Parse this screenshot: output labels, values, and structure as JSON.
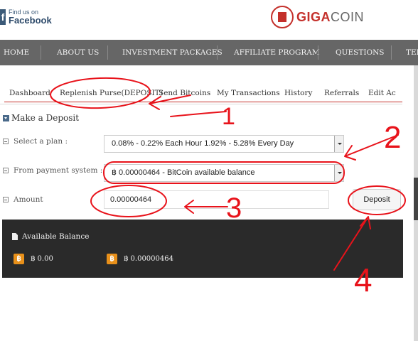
{
  "header": {
    "facebook": {
      "small": "Find us on",
      "big": "Facebook",
      "icon": "facebook-icon"
    },
    "logo": {
      "giga": "GIGA",
      "coin": "COIN",
      "icon": "gigacoin-seal-icon"
    }
  },
  "nav": {
    "items": [
      "HOME",
      "ABOUT US",
      "INVESTMENT PACKAGES",
      "AFFILIATE PROGRAM",
      "QUESTIONS",
      "TER"
    ]
  },
  "tabs": {
    "items": [
      "Dashboard",
      "Replenish Purse(DEPOSIT)",
      "Send Bitcoins",
      "My Transactions",
      "History",
      "Referrals",
      "Edit Ac"
    ]
  },
  "form": {
    "title": "Make a Deposit",
    "plan_label": "Select a plan :",
    "plan_value": "0.08% - 0.22% Each Hour 1.92% - 5.28% Every Day",
    "payment_label": "From payment system :",
    "payment_value": "฿ 0.00000464 - BitCoin available balance",
    "amount_label": "Amount",
    "amount_value": "0.00000464",
    "deposit_label": "Deposit"
  },
  "balance": {
    "title": "Available Balance",
    "coins": [
      {
        "symbol": "฿",
        "value": "฿ 0.00"
      },
      {
        "symbol": "฿",
        "value": "฿ 0.00000464"
      }
    ]
  },
  "annotations": {
    "labels": [
      "1",
      "2",
      "3",
      "4"
    ],
    "color": "#e8131b"
  },
  "colors": {
    "nav_bg": "#666666",
    "accent": "#c4302b",
    "panel_bg": "#2a2a2a",
    "bitcoin": "#e8901a"
  }
}
